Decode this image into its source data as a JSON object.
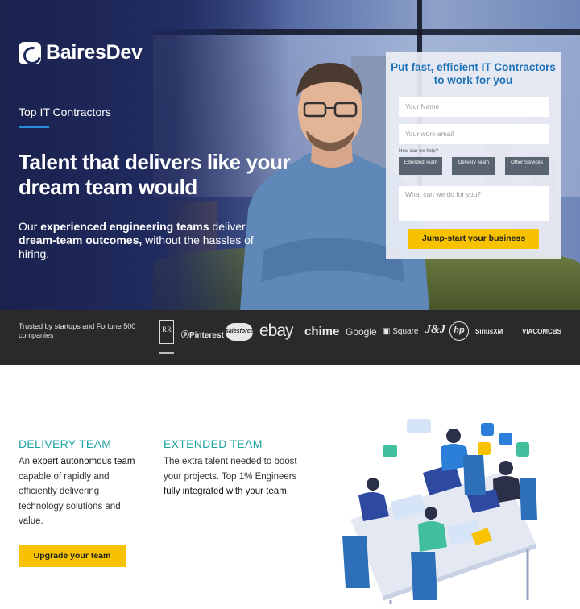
{
  "brand": {
    "name": "BairesDev"
  },
  "hero": {
    "eyebrow": "Top IT Contractors",
    "headline": "Talent that delivers like your dream team would",
    "sub_1": "Our ",
    "sub_2": "experienced engineering teams",
    "sub_3": " deliver ",
    "sub_4": "dream-team outcomes,",
    "sub_5": " without the hassles of hiring."
  },
  "form": {
    "title": "Put fast, efficient IT Contractors to work for you",
    "name_placeholder": "Your Name",
    "email_placeholder": "Your work email",
    "help_label": "How can we help?",
    "chips": [
      "Extended Team",
      "Delivery Team",
      "Other Services"
    ],
    "message_placeholder": "What can we do for you?",
    "submit_label": "Jump-start your business"
  },
  "trusted": {
    "text": "Trusted by startups and Fortune 500 companies",
    "logos": [
      "RR",
      "Pinterest",
      "salesforce",
      "ebay",
      "chime",
      "Google",
      "Square",
      "J&J",
      "hp",
      "SiriusXM",
      "VIACOMCBS"
    ]
  },
  "delivery": {
    "title": "DELIVERY TEAM",
    "body_1": "An ",
    "body_2": "expert autonomous team",
    "body_3": " capable of rapidly and efficiently delivering technology solutions and value.",
    "button": "Upgrade your team"
  },
  "extended": {
    "title": "EXTENDED TEAM",
    "body_1": "The extra talent needed to boost your projects. Top 1% Engineers ",
    "body_2": "fully integrated with your team",
    "body_3": "."
  },
  "colors": {
    "accent_yellow": "#f7c300",
    "title_blue": "#1d72b8",
    "teal": "#1fa3a3",
    "navy": "#1f2a5c"
  }
}
